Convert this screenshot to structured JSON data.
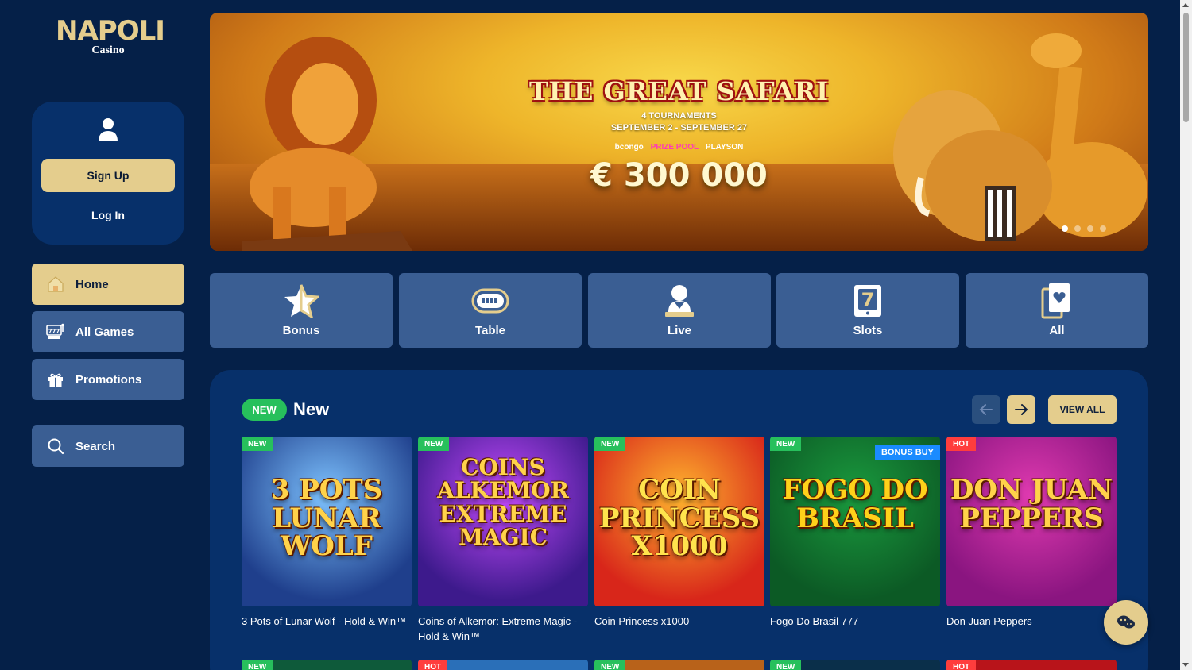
{
  "brand": {
    "name": "NAPOLI",
    "sub": "Casino"
  },
  "account": {
    "signup_label": "Sign Up",
    "login_label": "Log In"
  },
  "nav": [
    {
      "label": "Home",
      "icon": "home-icon",
      "active": true
    },
    {
      "label": "All Games",
      "icon": "slot-machine-icon",
      "active": false
    },
    {
      "label": "Promotions",
      "icon": "gift-icon",
      "active": false
    },
    {
      "label": "Search",
      "icon": "search-icon",
      "active": false
    }
  ],
  "banner": {
    "title": "THE GREAT SAFARI",
    "line1": "4 TOURNAMENTS",
    "line2": "SEPTEMBER 2 - SEPTEMBER 27",
    "brands": [
      "bcongo",
      "PRIZE POOL",
      "PLAYSON"
    ],
    "prize": "€ 300 000",
    "slides": 4,
    "active_slide": 1
  },
  "categories": [
    {
      "label": "Bonus",
      "icon": "star-icon"
    },
    {
      "label": "Table",
      "icon": "table-icon"
    },
    {
      "label": "Live",
      "icon": "dealer-icon"
    },
    {
      "label": "Slots",
      "icon": "slot-icon"
    },
    {
      "label": "All",
      "icon": "cards-icon"
    }
  ],
  "section": {
    "badge": "NEW",
    "title": "New",
    "view_all": "VIEW ALL"
  },
  "games": [
    {
      "name": "3 Pots of Lunar Wolf - Hold & Win™",
      "tag": "NEW",
      "art": "3 POTS\nLUNAR\nWOLF",
      "bg1": "#1f3f8c",
      "bg2": "#7ec3ff",
      "art_color": "#ffd24a"
    },
    {
      "name": "Coins of Alkemor: Extreme Magic - Hold & Win™",
      "tag": "NEW",
      "art": "COINS\nALKEMOR\nEXTREME\nMAGIC",
      "bg1": "#3d1a8c",
      "bg2": "#c64bff",
      "art_color": "#ffd24a"
    },
    {
      "name": "Coin Princess x1000",
      "tag": "NEW",
      "art": "COIN\nPRINCESS\nX1000",
      "bg1": "#d8261a",
      "bg2": "#ffb52e",
      "art_color": "#ffe34d"
    },
    {
      "name": "Fogo Do Brasil 777",
      "tag": "NEW",
      "badge": "BONUS BUY",
      "art": "FOGO DO\nBRASIL",
      "bg1": "#0c5a25",
      "bg2": "#1a9a3e",
      "art_color": "#ffd11a"
    },
    {
      "name": "Don Juan Peppers",
      "tag": "HOT",
      "art": "DON JUAN\nPEPPERS",
      "bg1": "#8a1580",
      "bg2": "#e03ab0",
      "art_color": "#ffd24a"
    }
  ],
  "next_row_tags": [
    "NEW",
    "HOT",
    "NEW",
    "NEW",
    "HOT"
  ],
  "colors": {
    "background": "#052048",
    "panel": "#07306a",
    "tile": "#3a5e93",
    "accent": "#e4cd8d",
    "new_green": "#27c05c",
    "hot_red": "#ff3d3d"
  }
}
